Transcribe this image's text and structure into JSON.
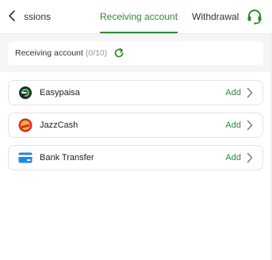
{
  "tabs": [
    {
      "label": "ing missions",
      "active": false
    },
    {
      "label": "Receiving account",
      "active": true
    },
    {
      "label": "Withdrawal I",
      "active": false
    }
  ],
  "header": {
    "title": "Receiving account",
    "count": "(0/10)"
  },
  "methods": [
    {
      "name": "Easypaisa",
      "action": "Add",
      "icon": "easypaisa-icon"
    },
    {
      "name": "JazzCash",
      "action": "Add",
      "icon": "jazzcash-icon"
    },
    {
      "name": "Bank Transfer",
      "action": "Add",
      "icon": "bank-card-icon"
    }
  ],
  "colors": {
    "accent": "#2f8a2f",
    "page_bg": "#f5f5f5",
    "card_bg": "#ffffff",
    "border": "#e3e3e3"
  }
}
